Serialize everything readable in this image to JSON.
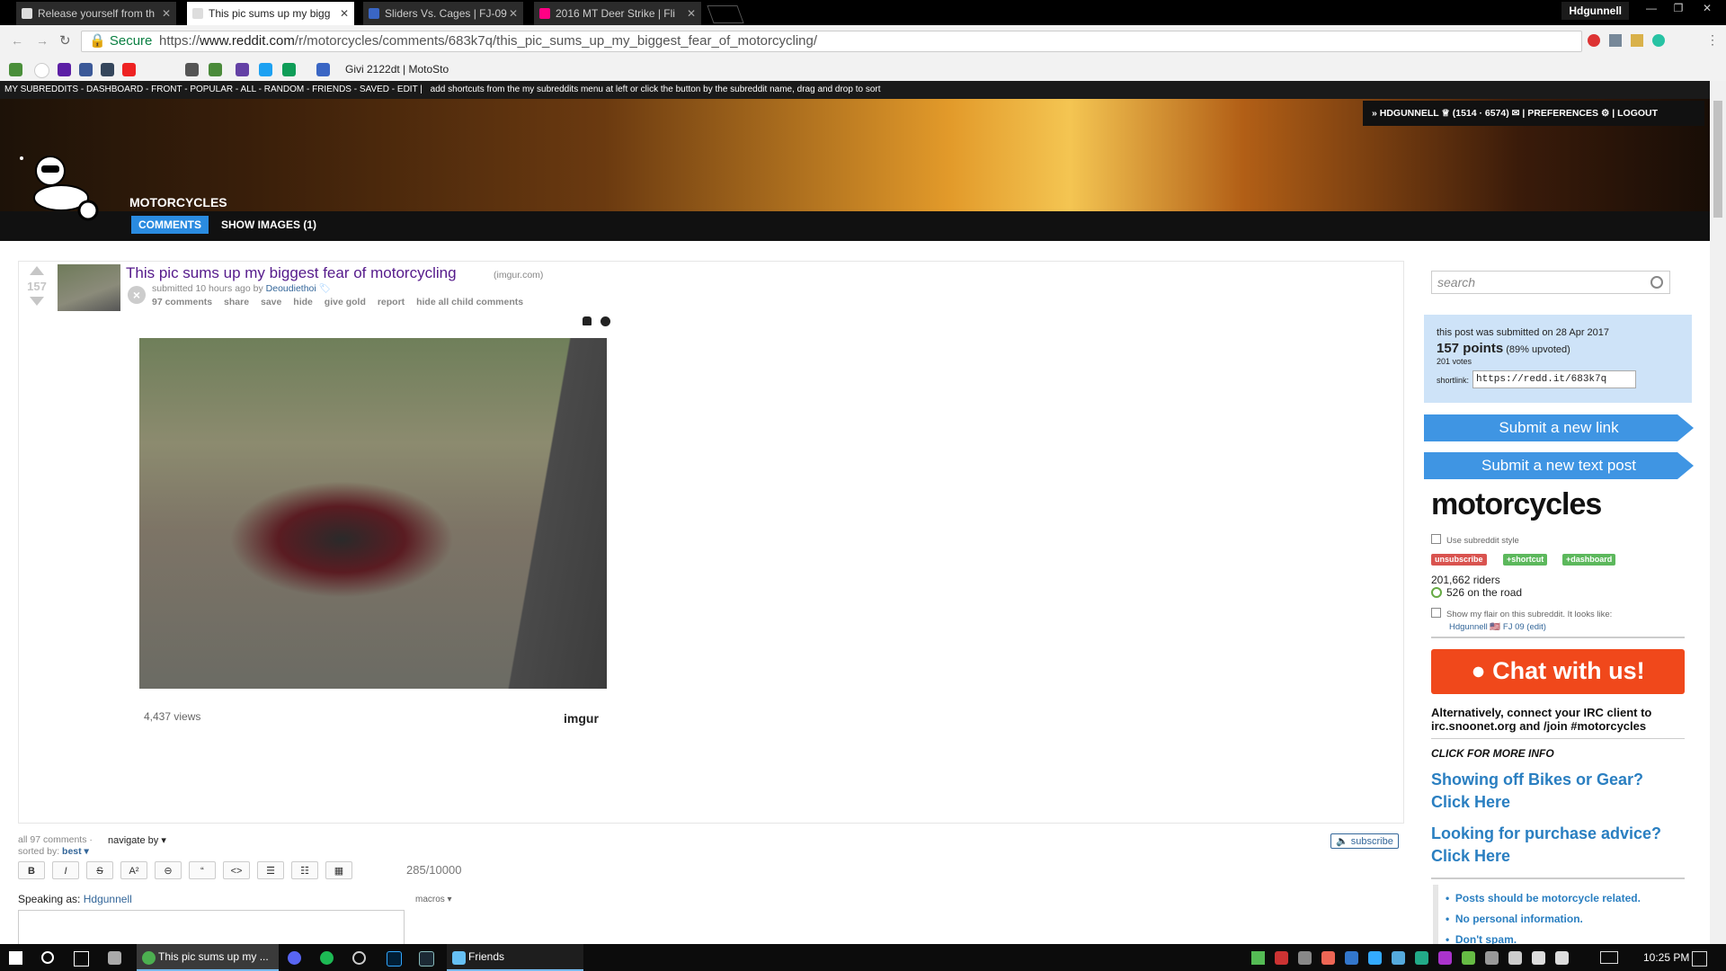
{
  "browser": {
    "tabs": [
      {
        "title": "Release yourself from th"
      },
      {
        "title": "This pic sums up my bigg"
      },
      {
        "title": "Sliders Vs. Cages | FJ-09"
      },
      {
        "title": "2016 MT Deer Strike | Fli"
      }
    ],
    "user": "Hdgunnell",
    "secure_label": "Secure",
    "url_scheme": "https://",
    "url_host": "www.reddit.com",
    "url_path": "/r/motorcycles/comments/683k7q/this_pic_sums_up_my_biggest_fear_of_motorcycling/",
    "bookmark_label": "Givi 2122dt | MotoSto"
  },
  "srbar": {
    "links": "MY SUBREDDITS - DASHBOARD - FRONT - POPULAR - ALL - RANDOM - FRIENDS - SAVED - EDIT |",
    "hint": "add shortcuts from the my subreddits menu at left or click the button by the subreddit name, drag and drop to sort"
  },
  "header": {
    "subreddit": "MOTORCYCLES",
    "tab_comments": "COMMENTS",
    "tab_images": "SHOW IMAGES (1)",
    "userbox": "» HDGUNNELL ♕ (1514 · 6574) ✉ | PREFERENCES ⚙ | LOGOUT"
  },
  "post": {
    "score": "157",
    "title": "This pic sums up my biggest fear of motorcycling",
    "domain": "(imgur.com)",
    "submitted": "submitted 10 hours ago by",
    "author": "Deoudiethoi",
    "actions": [
      "97 comments",
      "share",
      "save",
      "hide",
      "give gold",
      "report",
      "hide all child comments"
    ],
    "views": "4,437 views",
    "imgur": "imgur"
  },
  "comments": {
    "all": "all 97 comments ·",
    "navigate": "navigate by ▾",
    "sorted_label": "sorted by:",
    "sorted_value": "best ▾",
    "subscribe": "🔈 subscribe",
    "toolbar": [
      "B",
      "I",
      "S",
      "A²",
      "⊖",
      "“",
      "<>",
      "☰",
      "☷",
      "▦"
    ],
    "charcount": "285/10000",
    "speaking_label": "Speaking as:",
    "speaking_user": "Hdgunnell",
    "macros": "macros ▾"
  },
  "sidebar": {
    "search_placeholder": "search",
    "info_submitted": "this post was submitted on 28 Apr 2017",
    "info_points": "157 points",
    "info_upvoted": "(89% upvoted)",
    "info_votes": "201 votes",
    "shortlink_label": "shortlink:",
    "shortlink": "https://redd.it/683k7q",
    "submit_link": "Submit a new link",
    "submit_text": "Submit a new text post",
    "subreddit": "motorcycles",
    "use_style": "Use subreddit style",
    "pill_unsubscribe": "unsubscribe",
    "pill_shortcut": "+shortcut",
    "pill_dashboard": "+dashboard",
    "riders": "201,662 riders",
    "on_road": "526 on the road",
    "flair_label": "Show my flair on this subreddit. It looks like:",
    "flair_example": "Hdgunnell 🇺🇸 FJ 09   (edit)",
    "chat": "Chat with us!",
    "irc": "Alternatively, connect your IRC client to irc.snoonet.org and /join #motorcycles",
    "more_info": "CLICK FOR MORE INFO",
    "link1": "Showing off Bikes or Gear? Click Here",
    "link2": "Looking for purchase advice? Click Here",
    "rules": [
      "Posts should be motorcycle related.",
      "No personal information.",
      "Don't spam."
    ]
  },
  "taskbar": {
    "chrome_label": "This pic sums up my ...",
    "friends_label": "Friends",
    "clock": "10:25 PM"
  },
  "colors": {
    "reddit_blue": "#3f95e3",
    "chat_orange": "#f0481b",
    "infobox": "#cee3f8",
    "title_visited": "#551a8b"
  }
}
